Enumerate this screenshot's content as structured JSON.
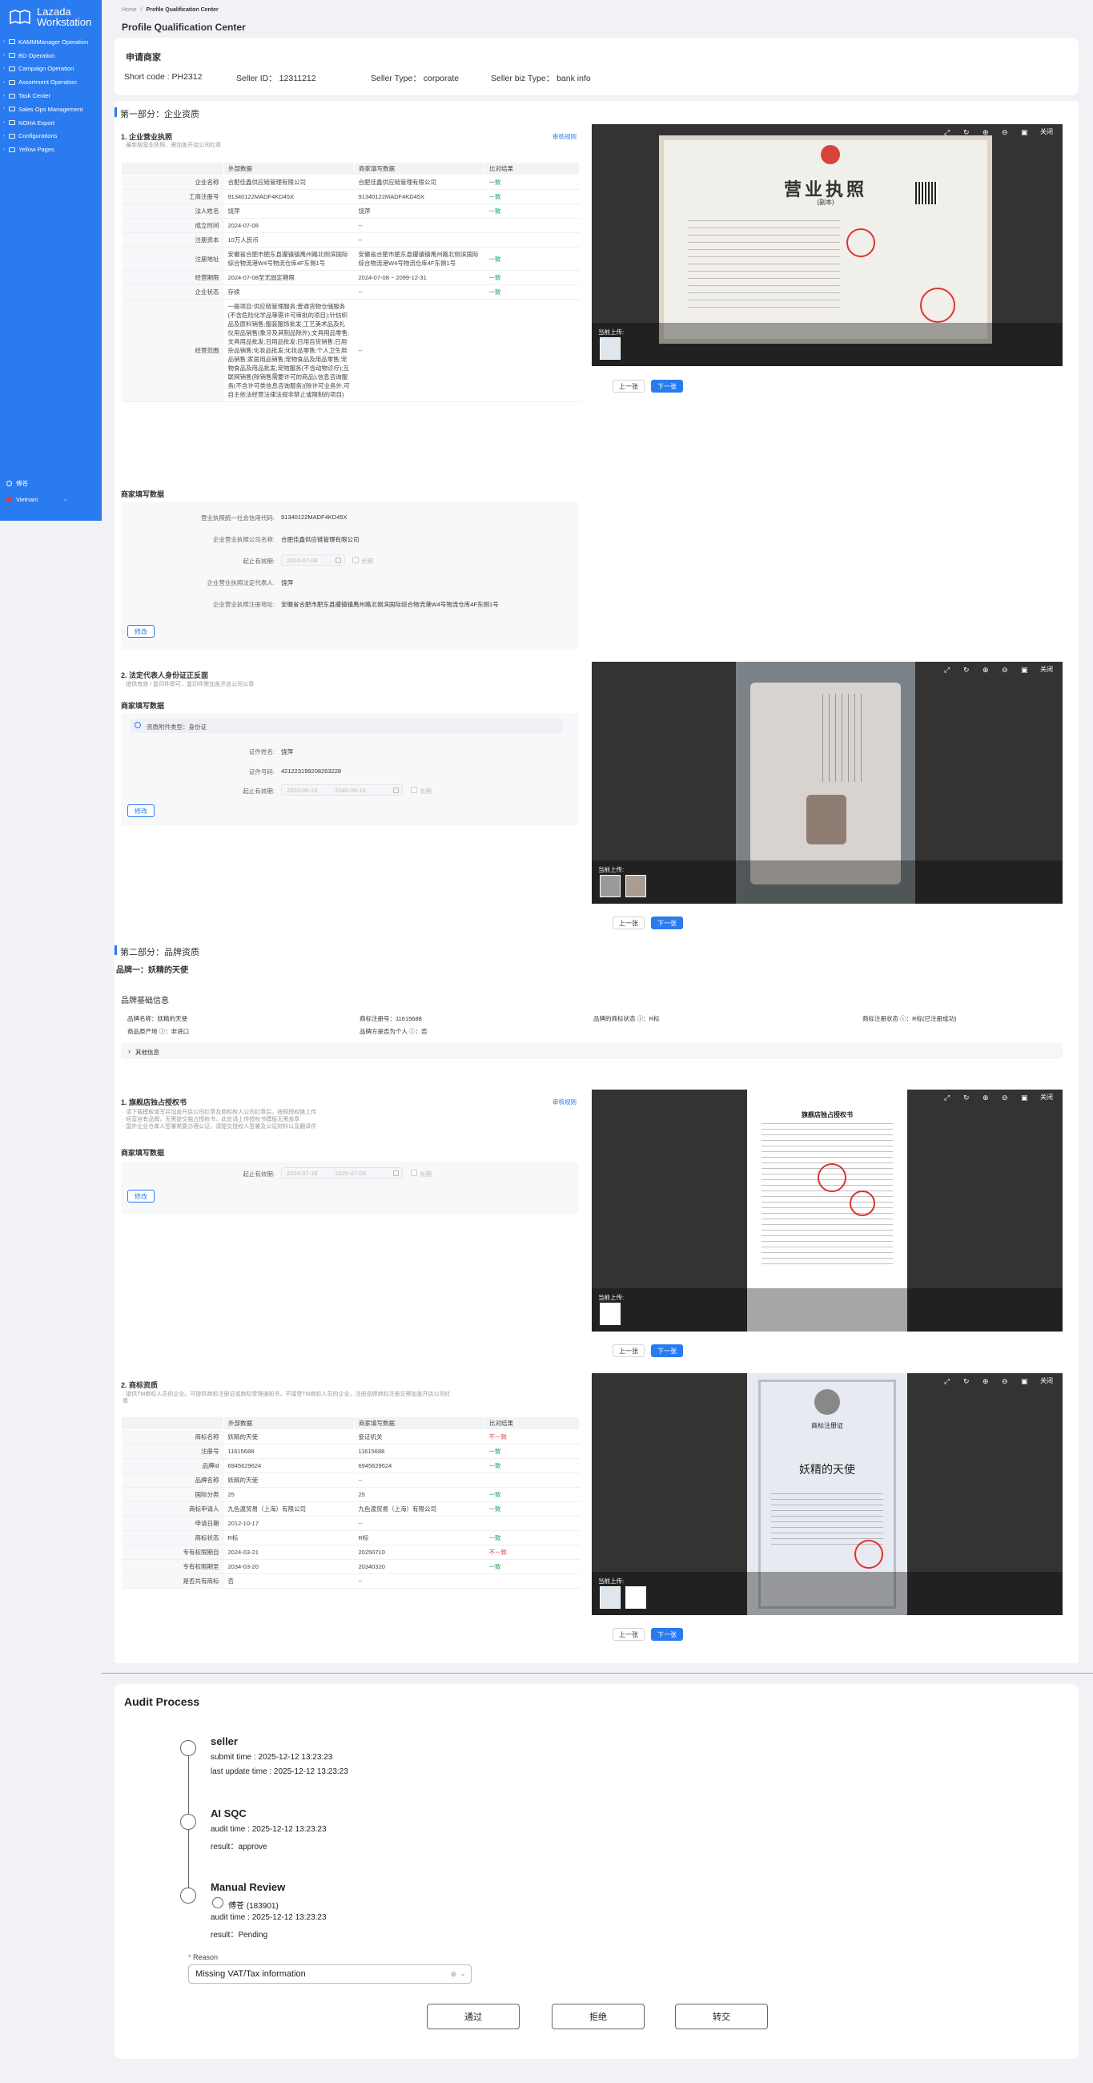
{
  "sidebar": {
    "logo_line1": "Lazada",
    "logo_line2": "Workstation",
    "items": [
      {
        "label": "KAMMManager Operation"
      },
      {
        "label": "BD Operation"
      },
      {
        "label": "Campaign Operation"
      },
      {
        "label": "Assortment Operation"
      },
      {
        "label": "Task Center"
      },
      {
        "label": "Sales Ops Management"
      },
      {
        "label": "NOHA Export"
      },
      {
        "label": "Configurations"
      },
      {
        "label": "Yellow Pages"
      }
    ],
    "user": "傅苍",
    "country": "Vietnam"
  },
  "breadcrumb": {
    "home": "Home",
    "sep": "/",
    "current": "Profile Qualification Center"
  },
  "page_title": "Profile Qualification Center",
  "applicant": {
    "title": "申请商家",
    "short_code": "Short code : PH2312",
    "seller_id": "Seller ID： 12311212",
    "seller_type": "Seller Type： corporate",
    "seller_biz_type": "Seller biz Type： bank info"
  },
  "part1": {
    "title": "第一部分：企业资质",
    "license": {
      "title": "1. 企业营业执照",
      "hint": "· 最新版营业执照、需加盖开店公司红章",
      "audit_link": "审核规则",
      "headers": [
        "",
        "外部数据",
        "商家填写数据",
        "比对结果"
      ],
      "rows": [
        {
          "label": "企业名称",
          "ext": "合肥佳鑫供应链管理有限公司",
          "filled": "合肥佳鑫供应链管理有限公司",
          "result": "一致"
        },
        {
          "label": "工商注册号",
          "ext": "91340122MADF4KD45X",
          "filled": "91340122MADF4KD45X",
          "result": "一致"
        },
        {
          "label": "法人姓名",
          "ext": "饶萍",
          "filled": "饶萍",
          "result": "一致"
        },
        {
          "label": "成立时间",
          "ext": "2024-07-08",
          "filled": "--",
          "result": ""
        },
        {
          "label": "注册资本",
          "ext": "10万人民币",
          "filled": "--",
          "result": ""
        },
        {
          "label": "注册地址",
          "ext": "安徽省合肥市肥东县撮镇镇禹州路北侧滨国际综合物流港W4号物流仓库4F东侧1号",
          "filled": "安徽省合肥市肥东县撮镇镇禹州路北侧滨国际综合物流港W4号物流仓库4F东侧1号",
          "result": "一致"
        },
        {
          "label": "经营期限",
          "ext": "2024-07-08至无固定期限",
          "filled": "2024-07-08 ~ 2099-12-31",
          "result": "一致"
        },
        {
          "label": "企业状态",
          "ext": "存续",
          "filled": "--",
          "result": "一致"
        },
        {
          "label": "经营范围",
          "ext": "一般项目:供应链管理服务;普通货物仓储服务(不含危险化学品等需许可审批的项目);针纺织品及原料销售;服装服饰批发;工艺美术品及礼仪用品销售(象牙及其制品除外);文具用品零售;文具用品批发;日用品批发;日用百货销售;日用杂品销售;化妆品批发;化妆品零售;个人卫生用品销售;家居用品销售;宠物食品及用品零售;宠物食品及用品批发;宠物服务(不含动物诊疗);互联网销售(除销售需要许可的商品);信息咨询服务(不含许可类信息咨询服务)(除许可业务外,可自主依法经营法律法规非禁止或限制的项目)",
          "filled": "--",
          "result": ""
        }
      ],
      "filled_title": "商家填写数据",
      "filled": {
        "credit_code_label": "营业执照统一社会信用代码:",
        "credit_code": "91340122MADF4KD45X",
        "company_label": "企业营业执照公司名称:",
        "company": "合肥佳鑫供应链管理有限公司",
        "validity_label": "起止有效期:",
        "validity_from": "2024-07-08",
        "permanent": "长期",
        "rep_label": "企业营业执照法定代表人:",
        "rep": "饶萍",
        "addr_label": "企业营业执照注册地址:",
        "addr": "安徽省合肥市肥东县撮镇镇禹州路北侧滨国际综合物流港W4号物流仓库4F东侧1号"
      },
      "edit": "修改",
      "thumb_label": "当前上传:",
      "doc_title": "营业执照",
      "doc_subtitle": "(副本)"
    },
    "id": {
      "title": "2. 法定代表人身份证正反面",
      "hint": "· 提供有效 / 复印件即可，复印件需加盖开店公司公章",
      "filled_title": "商家填写数据",
      "info": "资质附件类型：身份证",
      "name_label": "证件姓名:",
      "name": "饶萍",
      "number_label": "证件号码:",
      "number": "421223199208263228",
      "validity_label": "起止有效期:",
      "from": "2020-06-16",
      "to": "2040-06-16",
      "permanent": "长期",
      "edit": "修改",
      "thumb_label": "当前上传:"
    }
  },
  "part2": {
    "title": "第二部分：品牌资质",
    "brand_name": "品牌一：妖精的天使",
    "basic_title": "品牌基础信息",
    "basic": {
      "brand": "品牌名称：妖精的天使",
      "reg_no": "商标注册号：11615688",
      "tm_status": "品牌的商标状态 ⓘ：R标",
      "status": "商标注册状态 ⓘ：R标(已注册成功)",
      "origin": "商品原产地 ⓘ：非进口",
      "personal": "品牌方是否为个人 ⓘ：否"
    },
    "more": "其他信息",
    "auth": {
      "title": "1. 旗舰店独占授权书",
      "audit_link": "审核规则",
      "hint": "· 请下载模板填写并加盖开店公司红章及商标权人公司红章后，按照授权链上传\n· 经营自有品牌，无需提交独占授权书，此处请上传授权书模板无需盖章\n· 国外企业仓库人签署需要办理公证，请提交授权人签署及公证材料以及翻译件",
      "filled_title": "商家填写数据",
      "validity_label": "起止有效期:",
      "from": "2024-07-16",
      "to": "2025-07-09",
      "permanent": "长期",
      "edit": "修改",
      "thumb_label": "当前上传:",
      "doc_title": "旗舰店独占授权书"
    },
    "tm": {
      "title": "2. 商标资质",
      "hint": "· 提供TM商标人员的企业。可提供商标注册证或商标受理通知书，不接受TM商标人员的企业。注册品牌商标注册证需加盖开店公司红章",
      "headers": [
        "",
        "外部数据",
        "商家填写数据",
        "比对结果"
      ],
      "rows": [
        {
          "label": "商标名称",
          "ext": "妖精的天使",
          "filled": "妾证机关",
          "result": "不一致"
        },
        {
          "label": "注册号",
          "ext": "11615688",
          "filled": "11615688",
          "result": "一致"
        },
        {
          "label": "品牌id",
          "ext": "6945629624",
          "filled": "6945629624",
          "result": "一致"
        },
        {
          "label": "品牌名称",
          "ext": "妖精的天使",
          "filled": "--",
          "result": ""
        },
        {
          "label": "国际分类",
          "ext": "25",
          "filled": "25",
          "result": "一致"
        },
        {
          "label": "商标申请人",
          "ext": "九色渡贸易（上海）有限公司",
          "filled": "九色渡贸易（上海）有限公司",
          "result": "一致"
        },
        {
          "label": "申请日期",
          "ext": "2012-10-17",
          "filled": "--",
          "result": ""
        },
        {
          "label": "商标状态",
          "ext": "R标",
          "filled": "R标",
          "result": "一致"
        },
        {
          "label": "专有权限期自",
          "ext": "2024-03-21",
          "filled": "20250710",
          "result": "不一致"
        },
        {
          "label": "专有权限期至",
          "ext": "2034-03-20",
          "filled": "20340320",
          "result": "一致"
        },
        {
          "label": "是否共有商标",
          "ext": "否",
          "filled": "--",
          "result": ""
        }
      ],
      "thumb_label": "当前上传:",
      "doc_title": "商标注册证",
      "doc_brand": "妖精的天使"
    }
  },
  "viewer": {
    "close": "关闭",
    "prev": "上一张",
    "next": "下一张"
  },
  "audit": {
    "title": "Audit Process",
    "nodes": [
      {
        "name": "seller",
        "lines": [
          "submit time : 2025-12-12 13:23:23",
          "last update time : 2025-12-12 13:23:23"
        ]
      },
      {
        "name": "AI SQC",
        "lines": [
          "audit time : 2025-12-12 13:23:23",
          "result：approve"
        ]
      },
      {
        "name": "Manual Review",
        "reviewer": "傅苍 (183901)",
        "lines": [
          "audit time : 2025-12-12 13:23:23",
          "result：Pending"
        ]
      }
    ],
    "reason_label": "Reason",
    "reason_value": "Missing VAT/Tax information",
    "buttons": {
      "pass": "通过",
      "reject": "拒绝",
      "transfer": "转交"
    }
  },
  "colors": {
    "brand": "#2a7bf0",
    "ok": "#18a058",
    "bad": "#e5484d"
  }
}
